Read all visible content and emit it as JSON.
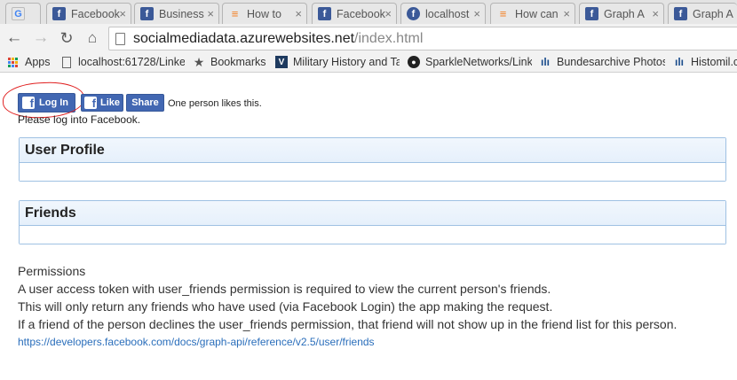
{
  "browser": {
    "tabs": [
      {
        "title": "",
        "icon": "google-icon"
      },
      {
        "title": "Facebook",
        "icon": "facebook-icon"
      },
      {
        "title": "Business",
        "icon": "facebook-icon"
      },
      {
        "title": "How to",
        "icon": "stackoverflow-icon"
      },
      {
        "title": "Facebook",
        "icon": "facebook-icon"
      },
      {
        "title": "localhost",
        "icon": "facebook-circle-icon"
      },
      {
        "title": "How can",
        "icon": "stackoverflow-icon"
      },
      {
        "title": "Graph A",
        "icon": "facebook-icon"
      },
      {
        "title": "Graph A",
        "icon": "facebook-icon"
      }
    ],
    "url_host": "socialmediadata.azurewebsites.net",
    "url_path": "/index.html",
    "bookmarks": [
      {
        "label": "Apps",
        "icon": "apps-grid-icon"
      },
      {
        "label": "localhost:61728/Linke",
        "icon": "page-icon"
      },
      {
        "label": "Bookmarks",
        "icon": "star-icon"
      },
      {
        "label": "Military History and Ta",
        "icon": "military-history-icon"
      },
      {
        "label": "SparkleNetworks/Link",
        "icon": "github-icon"
      },
      {
        "label": "Bundesarchive Photos",
        "icon": "bundesarchiv-icon"
      },
      {
        "label": "Histomil.c",
        "icon": "bundesarchiv-icon"
      }
    ]
  },
  "page": {
    "login_label": "Log In",
    "like_label": "Like",
    "share_label": "Share",
    "like_text": "One person likes this.",
    "login_note": "Please log into Facebook.",
    "user_profile_title": "User Profile",
    "friends_title": "Friends",
    "permissions": {
      "heading": "Permissions",
      "line1": "A user access token with user_friends permission is required to view the current person's friends.",
      "line2": "This will only return any friends who have used (via Facebook Login) the app making the request.",
      "line3": "If a friend of the person declines the user_friends permission, that friend will not show up in the friend list for this person.",
      "link": "https://developers.facebook.com/docs/graph-api/reference/v2.5/user/friends"
    }
  },
  "colors": {
    "facebook_blue": "#4267b2",
    "annotation_red": "#e02020",
    "panel_border": "#9fc1e3",
    "link": "#2a6ebb"
  }
}
